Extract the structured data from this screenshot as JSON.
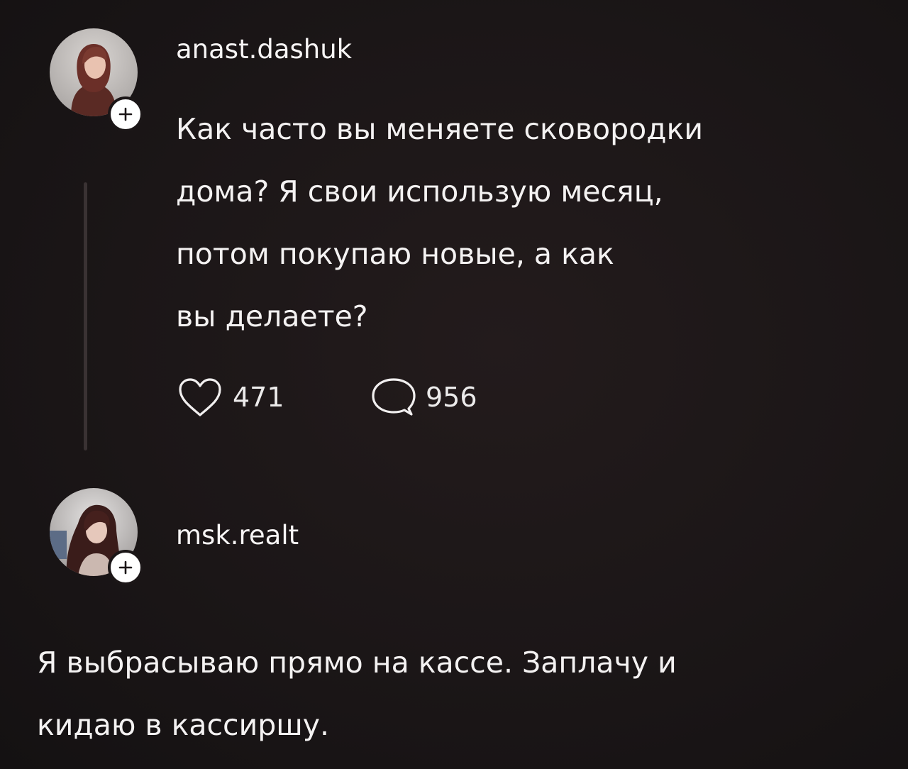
{
  "colors": {
    "background": "#1c1718",
    "text": "#f4f2f2",
    "thread_line": "#3a3233",
    "badge": "#ffffff"
  },
  "post": {
    "username": "anast.dashuk",
    "avatar_icon": "user-photo-avatar",
    "follow_icon": "plus-icon",
    "lines": [
      "Как часто вы меняете сковородки",
      "дома? Я свои использую месяц,",
      "потом покупаю новые, а как",
      "вы делаете?"
    ],
    "likes": "471",
    "comments": "956",
    "like_icon": "heart-icon",
    "comment_icon": "speech-bubble-icon"
  },
  "reply": {
    "username": "msk.realt",
    "avatar_icon": "user-photo-avatar",
    "follow_icon": "plus-icon",
    "lines": [
      "Я выбрасываю прямо на кассе. Заплачу и",
      "кидаю в кассиршу."
    ]
  }
}
